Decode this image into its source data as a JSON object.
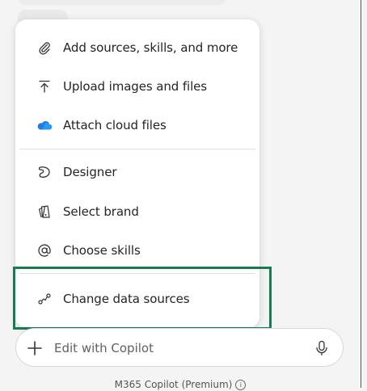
{
  "menu": {
    "items": [
      {
        "label": "Add sources, skills, and more",
        "icon": "paperclip-icon"
      },
      {
        "label": "Upload images and files",
        "icon": "upload-icon"
      },
      {
        "label": "Attach cloud files",
        "icon": "cloud-icon"
      },
      {
        "label": "Designer",
        "icon": "designer-icon"
      },
      {
        "label": "Select brand",
        "icon": "brand-kit-icon"
      },
      {
        "label": "Choose skills",
        "icon": "at-sign-icon"
      },
      {
        "label": "Change data sources",
        "icon": "data-source-icon"
      }
    ]
  },
  "composer": {
    "placeholder": "Edit with Copilot",
    "plus_icon": "plus-icon",
    "mic_icon": "microphone-icon"
  },
  "footer": {
    "label": "M365 Copilot (Premium)",
    "icon": "info-icon"
  },
  "colors": {
    "highlight": "#187a52",
    "cloud": "#1f7ee0"
  }
}
